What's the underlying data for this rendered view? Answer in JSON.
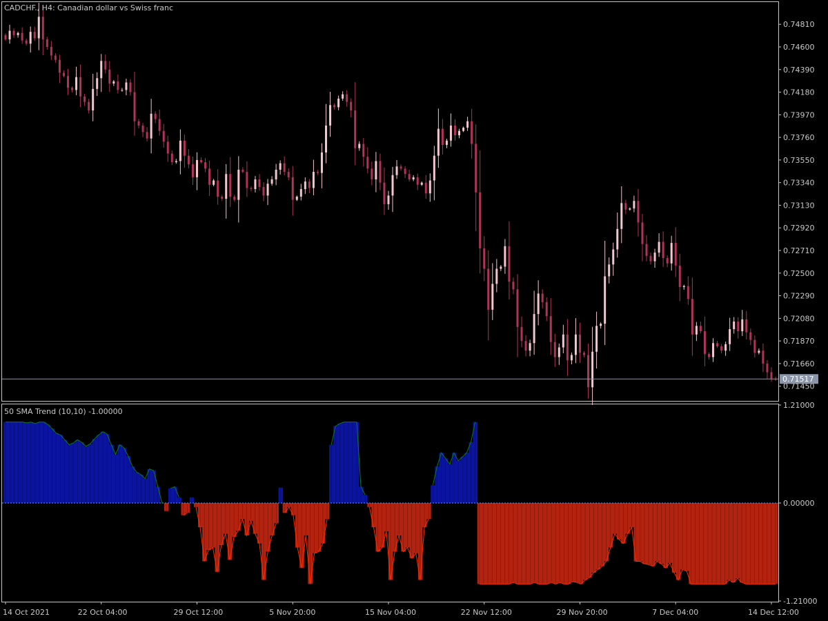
{
  "header": {
    "title": "CADCHF., H4:  Canadian dollar vs Swiss franc",
    "indicator_title": "50 SMA Trend (10,10) -1.00000"
  },
  "colors": {
    "background": "#000000",
    "frame": "#c8c8c8",
    "axis_text": "#c8c8c8",
    "candle_bull": "#f3c6d0",
    "candle_bear": "#b0335a",
    "current_price_line": "#8c96aa",
    "current_price_tag": "#8c96aa",
    "trend_up": "#0a14a0",
    "trend_down": "#b4230f",
    "trend_up_line": "#0a7a1a",
    "trend_down_line": "#ff2a00",
    "zero_line": "#5a8cff"
  },
  "chart_data": [
    {
      "type": "candlestick",
      "title": "CADCHF., H4:  Canadian dollar vs Swiss franc",
      "ylim": [
        0.7132,
        0.7501
      ],
      "y_ticks": [
        "0.74810",
        "0.74600",
        "0.74390",
        "0.74180",
        "0.73970",
        "0.73760",
        "0.73550",
        "0.73340",
        "0.73130",
        "0.72920",
        "0.72710",
        "0.72500",
        "0.72290",
        "0.72080",
        "0.71870",
        "0.71660",
        "0.71450"
      ],
      "y_tick_values": [
        0.7481,
        0.746,
        0.7439,
        0.7418,
        0.7397,
        0.7376,
        0.7355,
        0.7334,
        0.7313,
        0.7292,
        0.7271,
        0.725,
        0.7229,
        0.7208,
        0.7187,
        0.7166,
        0.7145
      ],
      "current_price": 0.71517,
      "current_price_label": "0.71517",
      "close_series": [
        0.7467,
        0.7475,
        0.7471,
        0.7473,
        0.7466,
        0.7463,
        0.7474,
        0.7468,
        0.7488,
        0.7467,
        0.746,
        0.7452,
        0.7448,
        0.7436,
        0.7433,
        0.7422,
        0.742,
        0.7432,
        0.7414,
        0.7409,
        0.7401,
        0.7421,
        0.7431,
        0.7447,
        0.7439,
        0.7426,
        0.7428,
        0.742,
        0.742,
        0.7427,
        0.7418,
        0.7391,
        0.7387,
        0.7381,
        0.7375,
        0.7398,
        0.7393,
        0.7382,
        0.7372,
        0.7361,
        0.7353,
        0.7354,
        0.7373,
        0.7359,
        0.7351,
        0.7339,
        0.7355,
        0.7353,
        0.7347,
        0.7332,
        0.7336,
        0.7321,
        0.7319,
        0.7342,
        0.7321,
        0.7318,
        0.7346,
        0.7344,
        0.7329,
        0.7328,
        0.7337,
        0.733,
        0.7322,
        0.7333,
        0.7337,
        0.7346,
        0.7352,
        0.7344,
        0.7339,
        0.7318,
        0.7321,
        0.7328,
        0.7335,
        0.7329,
        0.7344,
        0.7343,
        0.7362,
        0.7387,
        0.7406,
        0.7404,
        0.7412,
        0.7416,
        0.7409,
        0.7401,
        0.7366,
        0.737,
        0.7358,
        0.7347,
        0.7337,
        0.7354,
        0.7334,
        0.7314,
        0.7322,
        0.7341,
        0.7349,
        0.7347,
        0.7342,
        0.7337,
        0.7339,
        0.7332,
        0.7334,
        0.7324,
        0.7336,
        0.7359,
        0.7384,
        0.7369,
        0.7373,
        0.7387,
        0.7378,
        0.7382,
        0.7385,
        0.7391,
        0.737,
        0.7325,
        0.7273,
        0.7254,
        0.7216,
        0.724,
        0.7254,
        0.7256,
        0.7275,
        0.7242,
        0.7235,
        0.72,
        0.7187,
        0.7178,
        0.7185,
        0.7212,
        0.7231,
        0.7223,
        0.721,
        0.7186,
        0.7172,
        0.7181,
        0.7193,
        0.7169,
        0.7174,
        0.7193,
        0.7176,
        0.7174,
        0.7144,
        0.7177,
        0.7201,
        0.7203,
        0.7247,
        0.7258,
        0.7272,
        0.7291,
        0.7315,
        0.7309,
        0.731,
        0.7317,
        0.7297,
        0.7277,
        0.7266,
        0.7261,
        0.7269,
        0.7279,
        0.7264,
        0.7259,
        0.7278,
        0.7257,
        0.7237,
        0.7238,
        0.7226,
        0.7193,
        0.7201,
        0.7196,
        0.7175,
        0.7172,
        0.7185,
        0.7182,
        0.7178,
        0.7184,
        0.7198,
        0.7205,
        0.7196,
        0.7207,
        0.7195,
        0.7188,
        0.7176,
        0.7178,
        0.7166,
        0.7158,
        0.7152,
        0.71517
      ]
    },
    {
      "type": "histogram",
      "title": "50 SMA Trend (10,10) -1.00000",
      "ylim": [
        -1.21,
        1.21
      ],
      "y_ticks": [
        "1.21000",
        "0.00000",
        "-1.21000"
      ],
      "y_tick_values": [
        1.21,
        0.0,
        -1.21
      ],
      "colors": {
        "positive": "#0a14a0",
        "negative": "#b4230f"
      },
      "values": [
        1.0,
        1.0,
        1.0,
        1.0,
        1.0,
        0.99,
        1.0,
        0.98,
        1.0,
        1.0,
        0.97,
        0.92,
        0.86,
        0.84,
        0.78,
        0.72,
        0.74,
        0.78,
        0.75,
        0.7,
        0.73,
        0.79,
        0.84,
        0.88,
        0.85,
        0.72,
        0.6,
        0.72,
        0.68,
        0.58,
        0.45,
        0.38,
        0.35,
        0.3,
        0.42,
        0.4,
        0.2,
        0.0,
        -0.1,
        0.18,
        0.2,
        0.07,
        -0.15,
        -0.12,
        0.07,
        -0.05,
        -0.3,
        -0.72,
        -0.58,
        -0.55,
        -0.85,
        -0.52,
        -0.38,
        -0.7,
        -0.42,
        -0.34,
        -0.2,
        -0.4,
        -0.22,
        -0.38,
        -0.5,
        -0.95,
        -0.6,
        -0.4,
        -0.25,
        0.19,
        -0.12,
        -0.05,
        -0.15,
        -0.55,
        -0.8,
        -0.4,
        -1.0,
        -0.62,
        -0.6,
        -0.5,
        -0.2,
        0.72,
        0.95,
        0.98,
        1.0,
        1.0,
        1.0,
        1.0,
        0.2,
        0.1,
        -0.05,
        -0.3,
        -0.6,
        -0.55,
        -0.35,
        -0.95,
        -0.6,
        -0.4,
        -0.6,
        -0.55,
        -0.68,
        -0.62,
        -0.95,
        -0.3,
        -0.2,
        0.22,
        0.45,
        0.62,
        0.55,
        0.48,
        0.62,
        0.52,
        0.57,
        0.62,
        0.75,
        1.0,
        -1.0,
        -1.0,
        -1.0,
        -1.0,
        -1.0,
        -1.0,
        -1.0,
        -1.0,
        -0.98,
        -1.0,
        -1.0,
        -1.0,
        -1.0,
        -0.98,
        -1.0,
        -1.0,
        -1.0,
        -0.98,
        -1.0,
        -0.98,
        -1.0,
        -1.0,
        -0.97,
        -0.98,
        -1.0,
        -0.95,
        -0.92,
        -0.86,
        -0.82,
        -0.78,
        -0.72,
        -0.55,
        -0.38,
        -0.45,
        -0.5,
        -0.38,
        -0.3,
        -0.72,
        -0.72,
        -0.75,
        -0.76,
        -0.78,
        -0.72,
        -0.75,
        -0.8,
        -0.74,
        -0.86,
        -0.95,
        -0.82,
        -0.84,
        -1.0,
        -1.0,
        -1.0,
        -1.0,
        -1.0,
        -1.0,
        -1.0,
        -1.0,
        -1.0,
        -0.95,
        -0.98,
        -0.93,
        -0.98,
        -1.0,
        -1.0,
        -1.0,
        -1.0,
        -1.0,
        -1.0,
        -1.0,
        -1.0
      ]
    }
  ],
  "x_axis": {
    "labels": [
      "14 Oct 2021",
      "22 Oct 04:00",
      "29 Oct 12:00",
      "5 Nov 20:00",
      "15 Nov 04:00",
      "22 Nov 12:00",
      "29 Nov 20:00",
      "7 Dec 04:00",
      "14 Dec 12:00"
    ],
    "label_bars": [
      0,
      23,
      46,
      69,
      92,
      115,
      138,
      161,
      184
    ]
  }
}
